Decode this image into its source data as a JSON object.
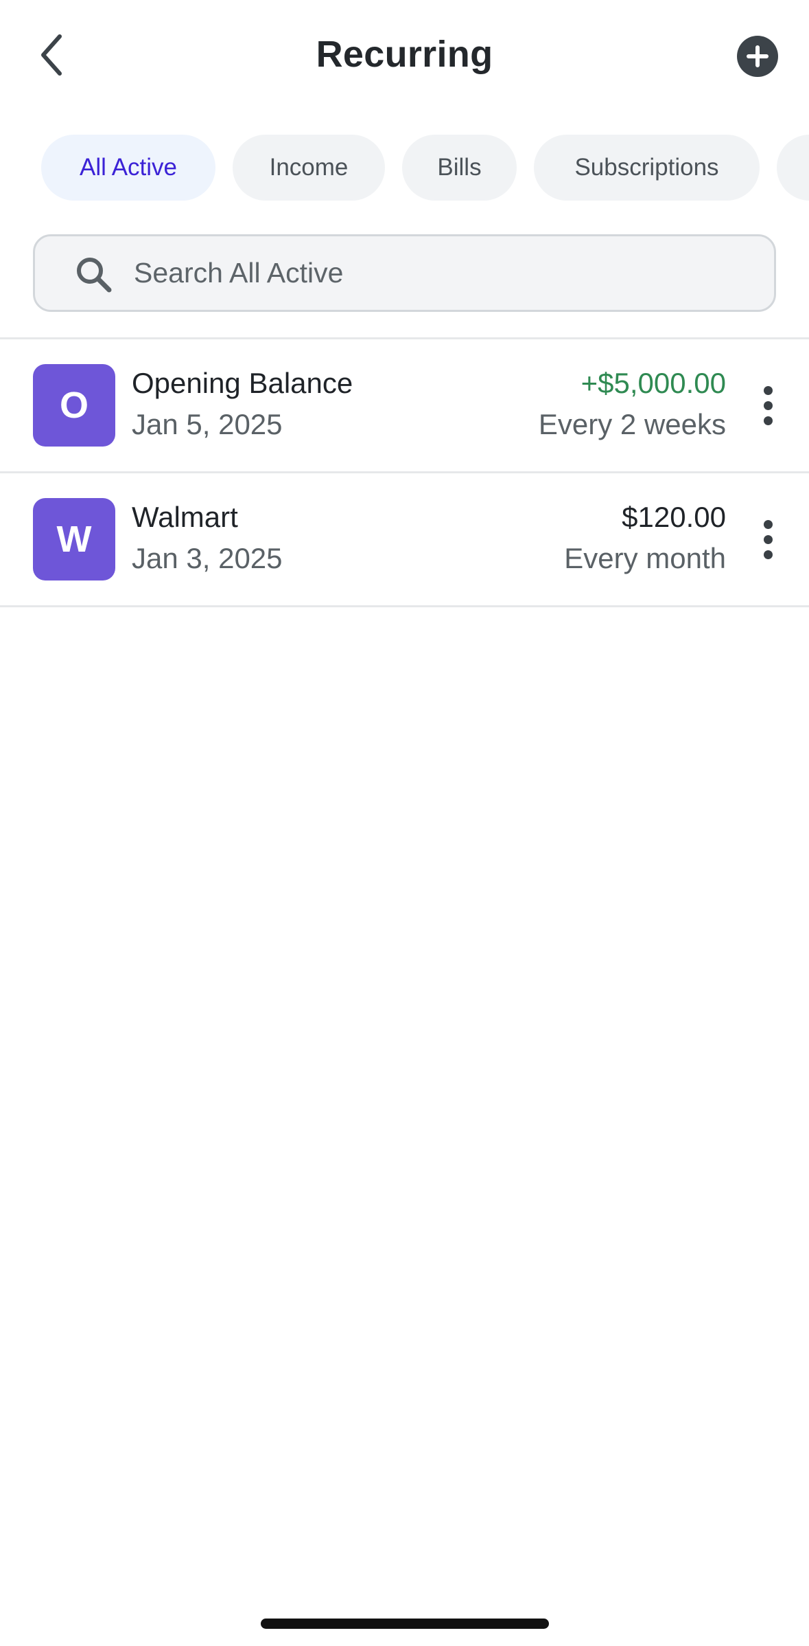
{
  "header": {
    "title": "Recurring",
    "back_icon": "chevron-left-icon",
    "add_icon": "plus-circle-icon"
  },
  "filters": [
    {
      "label": "All Active",
      "active": true
    },
    {
      "label": "Income",
      "active": false
    },
    {
      "label": "Bills",
      "active": false
    },
    {
      "label": "Subscriptions",
      "active": false
    },
    {
      "label": "",
      "active": false
    }
  ],
  "search": {
    "placeholder": "Search All Active",
    "value": "",
    "icon": "search-icon"
  },
  "items": [
    {
      "initial": "O",
      "name": "Opening Balance",
      "date": "Jan 5, 2025",
      "amount": "+$5,000.00",
      "frequency": "Every 2 weeks",
      "amount_color": "#2f8a52"
    },
    {
      "initial": "W",
      "name": "Walmart",
      "date": "Jan 3, 2025",
      "amount": "$120.00",
      "frequency": "Every month",
      "amount_color": "#1f2328"
    }
  ],
  "colors": {
    "accent": "#3b22d6",
    "avatar": "#6e56d8",
    "positive": "#2f8a52"
  }
}
